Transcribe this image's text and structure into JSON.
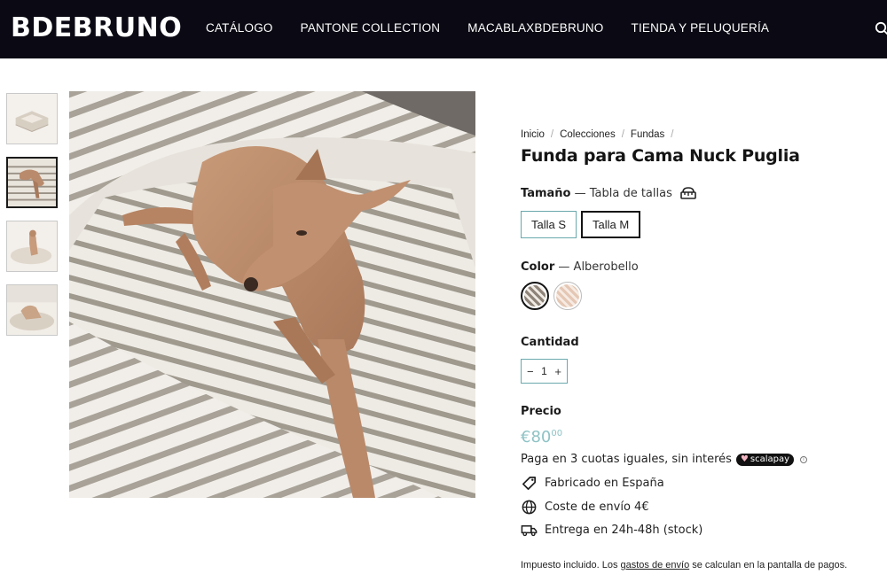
{
  "header": {
    "logo": "BDEBRUNO",
    "nav": [
      "CATÁLOGO",
      "PANTONE COLLECTION",
      "MACABLAXBDEBRUNO",
      "TIENDA Y PELUQUERÍA"
    ],
    "icons": [
      "search-icon"
    ]
  },
  "gallery": {
    "thumbnails": [
      "thumb-1",
      "thumb-2",
      "thumb-3",
      "thumb-4"
    ],
    "active_thumbnail_index": 1
  },
  "breadcrumb": {
    "items": [
      "Inicio",
      "Colecciones",
      "Fundas"
    ],
    "separator": "/"
  },
  "product": {
    "title": "Funda para Cama Nuck Puglia",
    "size": {
      "label": "Tamaño",
      "dash": " — ",
      "guide": "Tabla de tallas",
      "options": [
        "Talla S",
        "Talla M"
      ],
      "selected": "Talla M"
    },
    "color": {
      "label": "Color",
      "dash": " — ",
      "selected": "Alberobello",
      "swatch_colors": [
        "#8f8479",
        "#e4c7b4"
      ]
    },
    "quantity": {
      "label": "Cantidad",
      "minus": "−",
      "value": "1",
      "plus": "+"
    },
    "price": {
      "label": "Precio",
      "main": "€80",
      "cents": "00",
      "color": "#8fc3c5"
    },
    "installments": {
      "text": "Paga en 3 cuotas iguales, sin interés",
      "badge": "scalapay",
      "info": "i"
    },
    "features": [
      {
        "icon": "tag-icon",
        "text": "Fabricado en España"
      },
      {
        "icon": "globe-icon",
        "text": "Coste de envío 4€"
      },
      {
        "icon": "truck-icon",
        "text": "Entrega en 24h-48h (stock)"
      }
    ],
    "tax": {
      "before": "Impuesto incluido. Los ",
      "link": "gastos de envío",
      "after": " se calculan en la pantalla de pagos."
    }
  },
  "colors": {
    "header_bg": "#0b0a14",
    "accent_border": "#6aa9ad",
    "price": "#8fc3c5"
  }
}
